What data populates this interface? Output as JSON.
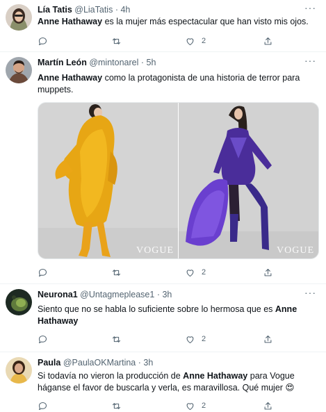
{
  "tweets": [
    {
      "name": "Lía Tatis",
      "handle": "@LiaTatis",
      "dot": "·",
      "time": "4h",
      "more": "···",
      "text": {
        "bold1": "Anne Hathaway",
        "rest1": " es la mujer más espectacular que han visto mis ojos."
      },
      "likes": "2"
    },
    {
      "name": "Martín León",
      "handle": "@mintonarel",
      "dot": "·",
      "time": "5h",
      "more": "···",
      "text": {
        "bold1": "Anne Hathaway",
        "rest1": " como la protagonista de una historia de terror para muppets."
      },
      "media": {
        "left_watermark": "VOGUE",
        "right_watermark": "VOGUE"
      },
      "likes": "2"
    },
    {
      "name": "Neurona1",
      "handle": "@Untagmeplease1",
      "dot": "·",
      "time": "3h",
      "more": "···",
      "text": {
        "rest1": "Siento que no se habla lo suficiente sobre lo hermosa que es ",
        "bold1": "Anne Hathaway"
      },
      "likes": "2"
    },
    {
      "name": "Paula",
      "handle": "@PaulaOKMartina",
      "dot": "·",
      "time": "3h",
      "more": "···",
      "text": {
        "rest1": "Si todavía no vieron la producción de ",
        "bold1": "Anne Hathaway",
        "rest2": " para Vogue háganse el favor de buscarla y verla, es maravillosa. Qué mujer ",
        "emoji": "😍"
      },
      "likes": "2"
    }
  ],
  "icons": {
    "reply": "reply-icon",
    "retweet": "retweet-icon",
    "like": "heart-icon",
    "share": "share-icon"
  },
  "colors": {
    "text": "#0f1419",
    "secondary": "#536471",
    "border": "#eff3f4"
  }
}
